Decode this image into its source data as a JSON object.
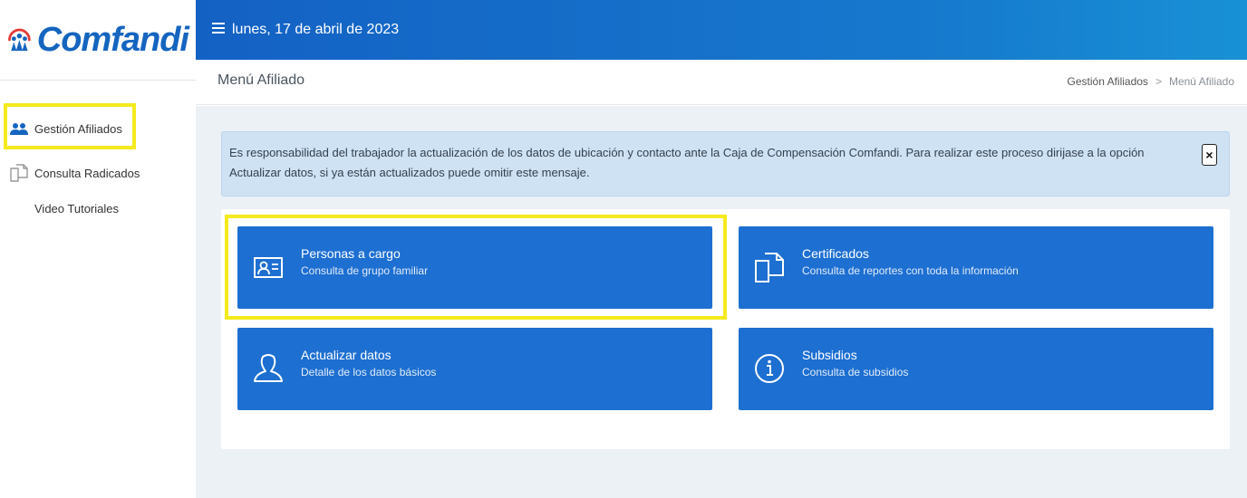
{
  "brand": {
    "name": "Comfandi"
  },
  "sidebar": {
    "items": [
      {
        "label": "Gestión Afiliados",
        "icon": "people-icon"
      },
      {
        "label": "Consulta Radicados",
        "icon": "documents-icon"
      },
      {
        "label": "Video Tutoriales",
        "icon": ""
      }
    ]
  },
  "topbar": {
    "menu_icon": "hamburger-icon",
    "date": "lunes, 17 de abril de 2023"
  },
  "header": {
    "title": "Menú Afiliado",
    "breadcrumb": {
      "parent": "Gestión Afiliados",
      "separator": ">",
      "current": "Menú Afiliado"
    }
  },
  "alert": {
    "text": "Es responsabilidad del trabajador la actualización de los datos de ubicación y contacto ante la Caja de Compensación Comfandi. Para realizar este proceso dirijase a la opción Actualizar datos, si ya están actualizados puede omitir este mensaje.",
    "close_label": "×"
  },
  "tiles": [
    {
      "title": "Personas a cargo",
      "subtitle": "Consulta de grupo familiar",
      "icon": "id-card-icon"
    },
    {
      "title": "Certificados",
      "subtitle": "Consulta de reportes con toda la información",
      "icon": "documents-icon"
    },
    {
      "title": "Actualizar datos",
      "subtitle": "Detalle de los datos básicos",
      "icon": "user-icon"
    },
    {
      "title": "Subsidios",
      "subtitle": "Consulta de subsidios",
      "icon": "info-icon"
    }
  ],
  "colors": {
    "topbar": "#1679cd",
    "tile": "#1d6fd1",
    "alert_bg": "#cfe2f3",
    "highlight": "#f4ea1d",
    "main_bg": "#ecf1f6"
  }
}
